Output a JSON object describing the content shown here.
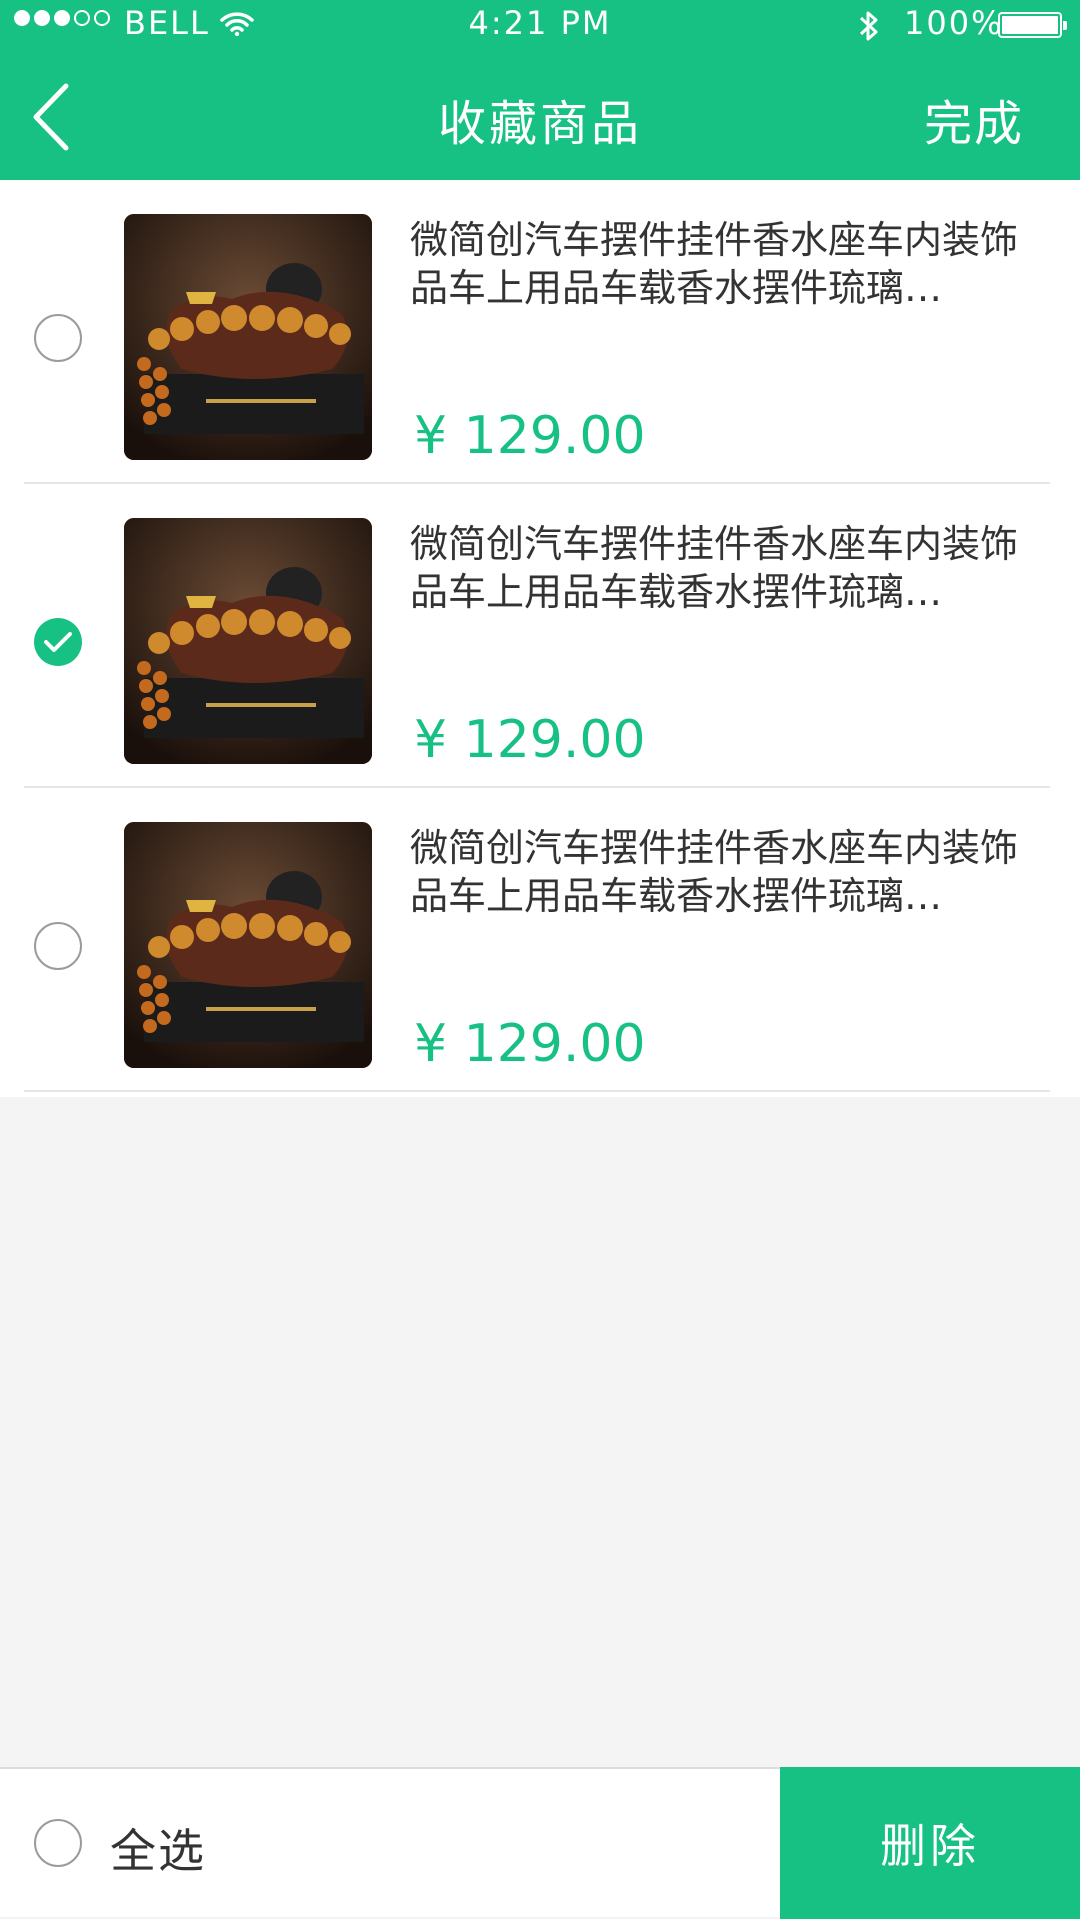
{
  "status_bar": {
    "carrier": "BELL",
    "time": "4:21 PM",
    "battery_percent": "100%",
    "signal_filled": 3,
    "signal_total": 5,
    "icons": [
      "signal-dots-icon",
      "wifi-icon",
      "bluetooth-icon",
      "battery-icon"
    ]
  },
  "header": {
    "title": "收藏商品",
    "done_label": "完成",
    "back_icon": "chevron-left-icon"
  },
  "items": [
    {
      "name": "微简创汽车摆件挂件香水座车内装饰品车上用品车载香水摆件琉璃…",
      "price": "¥ 129.00",
      "selected": false
    },
    {
      "name": "微简创汽车摆件挂件香水座车内装饰品车上用品车载香水摆件琉璃…",
      "price": "¥ 129.00",
      "selected": true
    },
    {
      "name": "微简创汽车摆件挂件香水座车内装饰品车上用品车载香水摆件琉璃…",
      "price": "¥ 129.00",
      "selected": false
    }
  ],
  "footer": {
    "select_all_label": "全选",
    "delete_label": "删除"
  },
  "colors": {
    "accent": "#17c184",
    "background": "#f4f4f4"
  }
}
